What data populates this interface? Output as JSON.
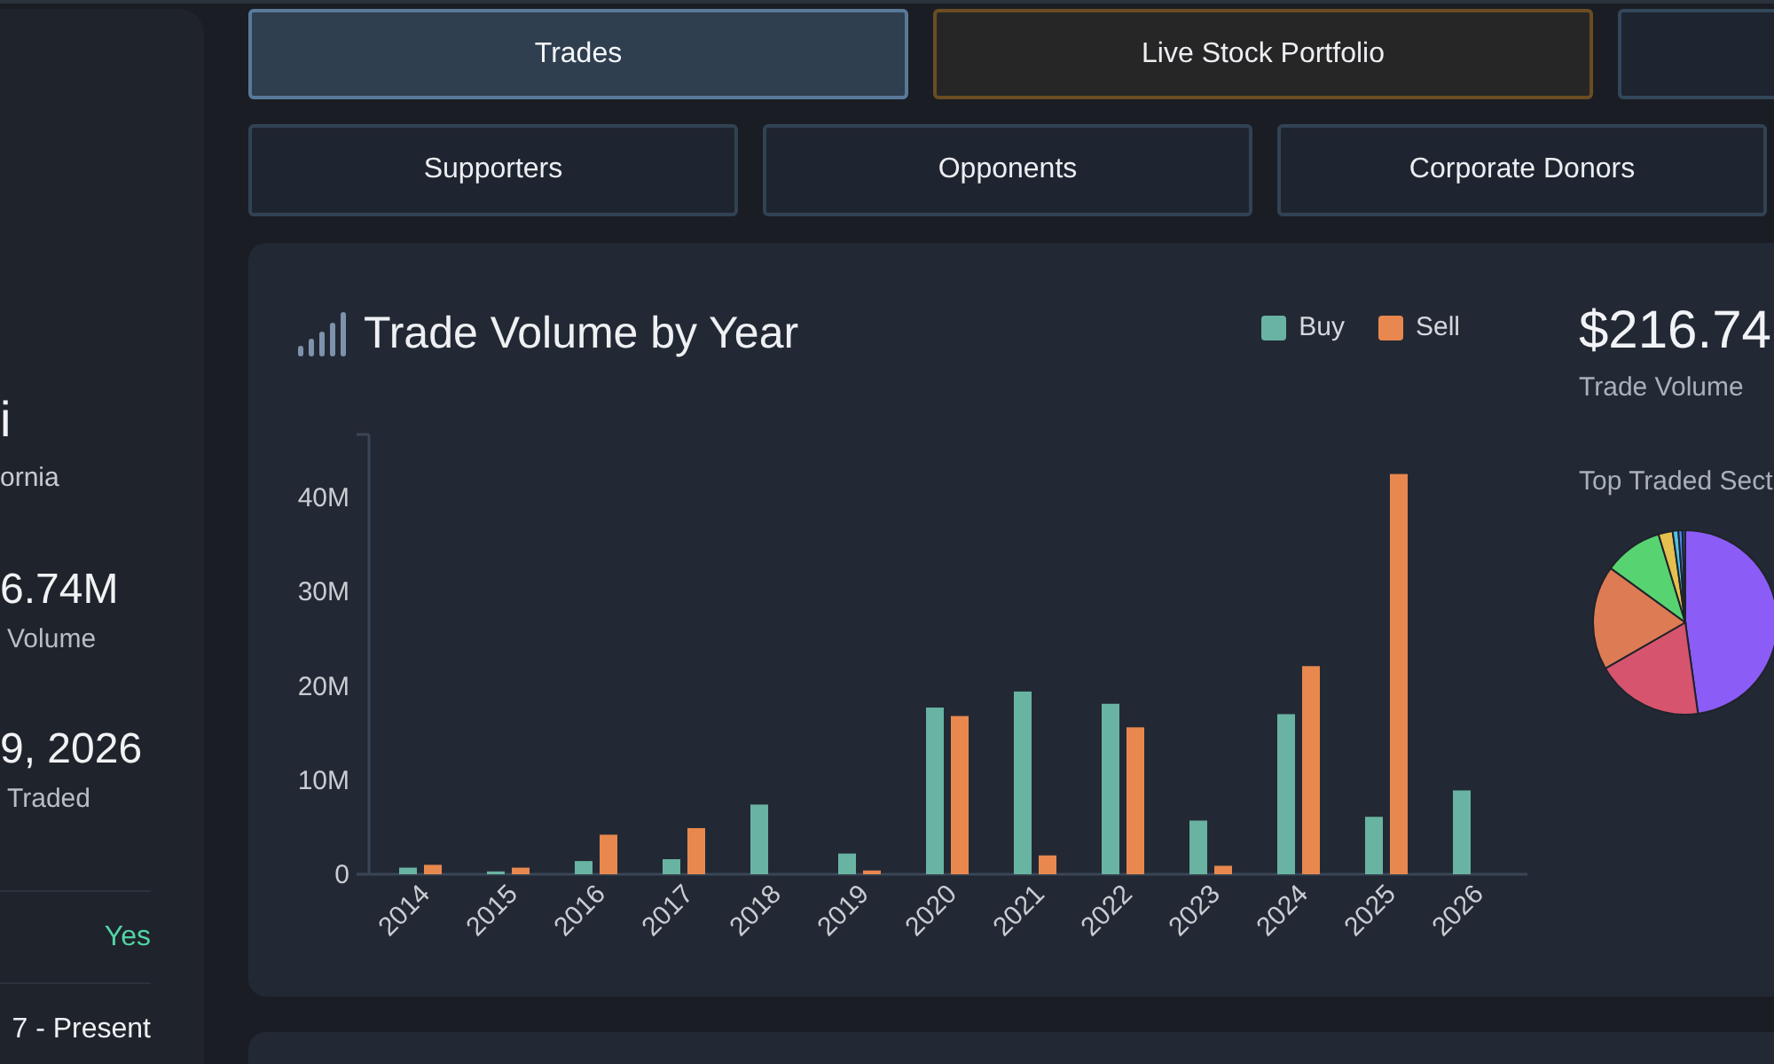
{
  "profile": {
    "name": "i",
    "location": "ornia",
    "stats": [
      {
        "value": "6.74M",
        "label": "Volume"
      },
      {
        "value": "9, 2026",
        "label": "Traded"
      }
    ],
    "details": [
      {
        "value": "Yes",
        "kind": "status"
      },
      {
        "value": "7 - Present",
        "kind": "text"
      }
    ]
  },
  "tabs": [
    {
      "label": "Trades",
      "selected": true,
      "kind": "standard"
    },
    {
      "label": "Live Stock Portfolio",
      "selected": false,
      "kind": "live"
    },
    {
      "selected": false,
      "kind": "standard"
    }
  ],
  "sub_tabs": [
    {
      "label": "Supporters",
      "selected": false
    },
    {
      "label": "Opponents",
      "selected": false
    },
    {
      "label": "Corporate Donors",
      "selected": false
    }
  ],
  "trade_volume": {
    "chart_data": {
      "type": "bar",
      "title": "Trade Volume by Year",
      "categories": [
        "2014",
        "2015",
        "2016",
        "2017",
        "2018",
        "2019",
        "2020",
        "2021",
        "2022",
        "2023",
        "2024",
        "2025",
        "2026"
      ],
      "series": [
        {
          "name": "Buy",
          "color": "#69b3a2",
          "values": [
            0.7,
            0.3,
            1.4,
            1.6,
            7.4,
            2.2,
            17.7,
            19.4,
            18.1,
            5.7,
            17.0,
            6.1,
            8.9
          ]
        },
        {
          "name": "Sell",
          "color": "#e8884f",
          "values": [
            1.0,
            0.7,
            4.2,
            4.9,
            0,
            0.4,
            16.8,
            2.0,
            15.6,
            0.9,
            22.1,
            42.5,
            0
          ]
        }
      ],
      "ylim": [
        0,
        46.7
      ],
      "yticks": [
        {
          "value": 0,
          "label": "0"
        },
        {
          "value": 10,
          "label": "10M"
        },
        {
          "value": 20,
          "label": "20M"
        },
        {
          "value": 30,
          "label": "30M"
        },
        {
          "value": 40,
          "label": "40M"
        }
      ]
    },
    "summary": {
      "value": "$216.74",
      "label": "Trade Volume"
    },
    "sectors": {
      "title": "Top Traded Sect"
    }
  }
}
